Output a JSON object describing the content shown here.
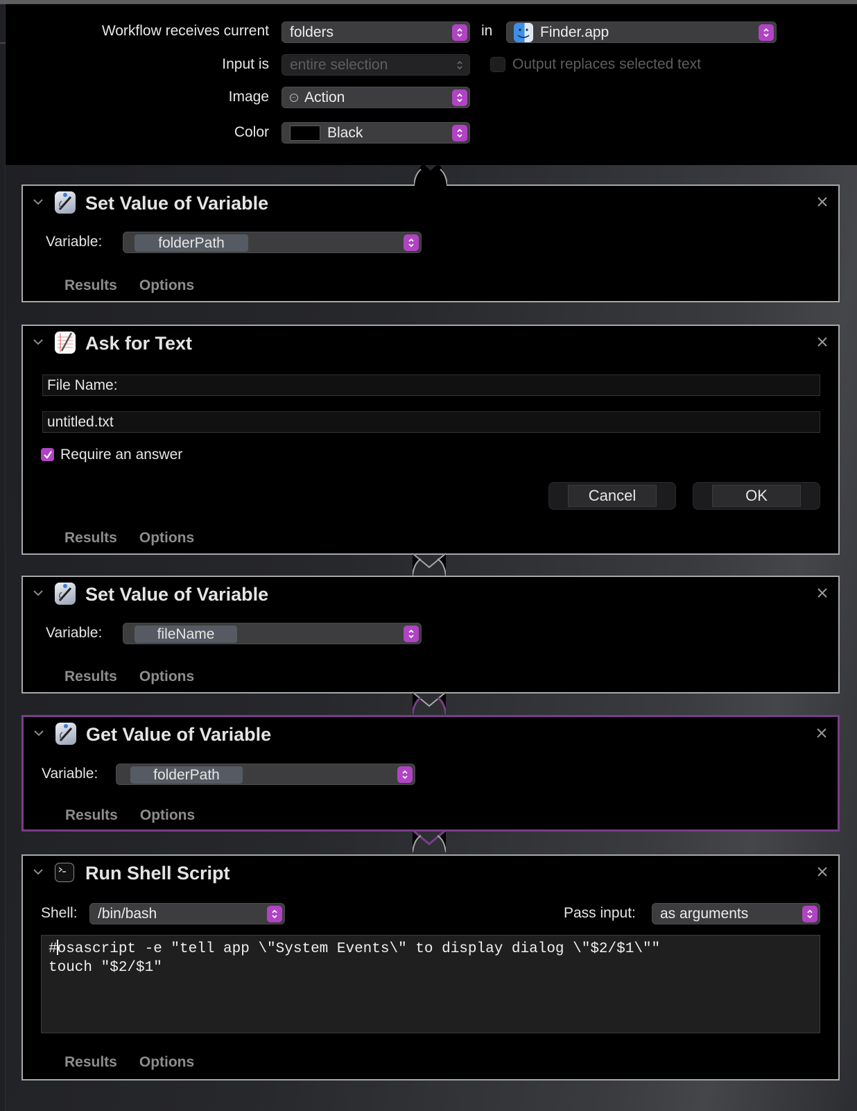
{
  "header": {
    "receives_label": "Workflow receives current",
    "receives_value": "folders",
    "in_label": "in",
    "app_value": "Finder.app",
    "input_is_label": "Input is",
    "input_is_value": "entire selection",
    "output_replaces_label": "Output replaces selected text",
    "output_replaces_checked": false,
    "image_label": "Image",
    "image_value": "Action",
    "color_label": "Color",
    "color_value": "Black",
    "color_swatch": "#000000"
  },
  "colors": {
    "accent": "#b044c4",
    "selected_border": "#7a3d88",
    "action_border": "#a8a8aa"
  },
  "actions": [
    {
      "title": "Set Value of Variable",
      "icon": "variable-icon",
      "variable_label": "Variable:",
      "variable_value": "folderPath",
      "tabs": [
        "Results",
        "Options"
      ]
    },
    {
      "title": "Ask for Text",
      "icon": "textedit-icon",
      "question": "File Name:",
      "default_answer": "untitled.txt",
      "require_label": "Require an answer",
      "require_checked": true,
      "cancel_label": "Cancel",
      "ok_label": "OK",
      "tabs": [
        "Results",
        "Options"
      ]
    },
    {
      "title": "Set Value of Variable",
      "icon": "variable-icon",
      "variable_label": "Variable:",
      "variable_value": "fileName",
      "tabs": [
        "Results",
        "Options"
      ]
    },
    {
      "title": "Get Value of Variable",
      "icon": "variable-icon",
      "selected": true,
      "variable_label": "Variable:",
      "variable_value": "folderPath",
      "tabs": [
        "Results",
        "Options"
      ]
    },
    {
      "title": "Run Shell Script",
      "icon": "terminal-icon",
      "shell_label": "Shell:",
      "shell_value": "/bin/bash",
      "pass_input_label": "Pass input:",
      "pass_input_value": "as arguments",
      "script_line1_prefix": "#",
      "script_line1_rest": "osascript -e \"tell app \\\"System Events\\\" to display dialog \\\"$2/$1\\\"\"",
      "script_line2": "touch \"$2/$1\"",
      "tabs": [
        "Results",
        "Options"
      ]
    }
  ]
}
